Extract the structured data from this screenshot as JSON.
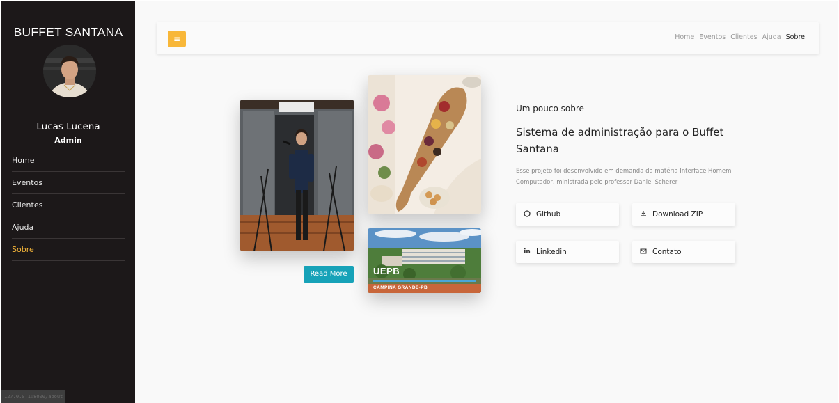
{
  "sidebar": {
    "brand": "BUFFET SANTANA",
    "user_name": "Lucas Lucena",
    "user_role": "Admin",
    "items": [
      {
        "label": "Home"
      },
      {
        "label": "Eventos"
      },
      {
        "label": "Clientes"
      },
      {
        "label": "Ajuda"
      },
      {
        "label": "Sobre"
      }
    ],
    "active_item": "Sobre",
    "accent_color": "#f8b739",
    "status_text": "127.0.0.1:8000/about"
  },
  "topbar": {
    "menu_icon": "hamburger-icon",
    "links": [
      {
        "label": "Home"
      },
      {
        "label": "Eventos"
      },
      {
        "label": "Clientes"
      },
      {
        "label": "Ajuda"
      },
      {
        "label": "Sobre"
      }
    ]
  },
  "images": {
    "uepb_title": "UEPB",
    "uepb_subtitle": "CAMPINA GRANDE-PB"
  },
  "read_more": "Read More",
  "about": {
    "heading_small": "Um pouco sobre",
    "heading": "Sistema de administração para o Buffet Santana",
    "description": "Esse projeto foi desenvolvido em demanda da matéria Interface Homem Computador, ministrada pelo professor Daniel Scherer"
  },
  "links": {
    "github": {
      "label": "Github",
      "icon": "github-icon"
    },
    "download": {
      "label": "Download ZIP",
      "icon": "download-icon"
    },
    "linkedin": {
      "label": "Linkedin",
      "icon": "linkedin-icon"
    },
    "contact": {
      "label": "Contato",
      "icon": "mail-icon"
    }
  },
  "colors": {
    "sidebar_bg": "#1c1819",
    "accent": "#f8b739",
    "read_more_bg": "#17a2b8"
  }
}
